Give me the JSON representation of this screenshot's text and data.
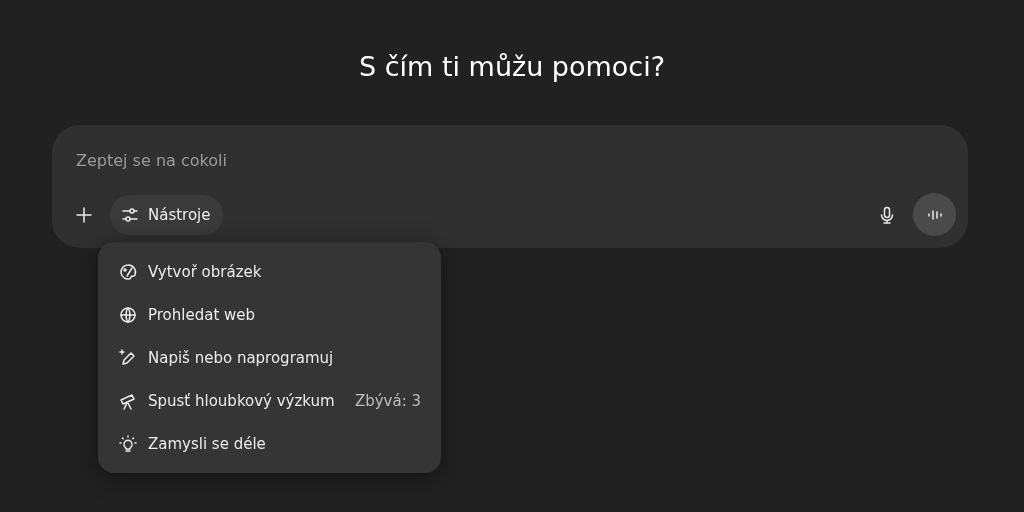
{
  "heading": "S čím ti můžu pomoci?",
  "composer": {
    "placeholder": "Zeptej se na cokoli",
    "tools_button": "Nástroje"
  },
  "tools_menu": [
    {
      "label": "Vytvoř obrázek"
    },
    {
      "label": "Prohledat web"
    },
    {
      "label": "Napiš nebo naprogramuj"
    },
    {
      "label": "Spusť hloubkový výzkum",
      "note": "Zbývá: 3"
    },
    {
      "label": "Zamysli se déle"
    }
  ]
}
